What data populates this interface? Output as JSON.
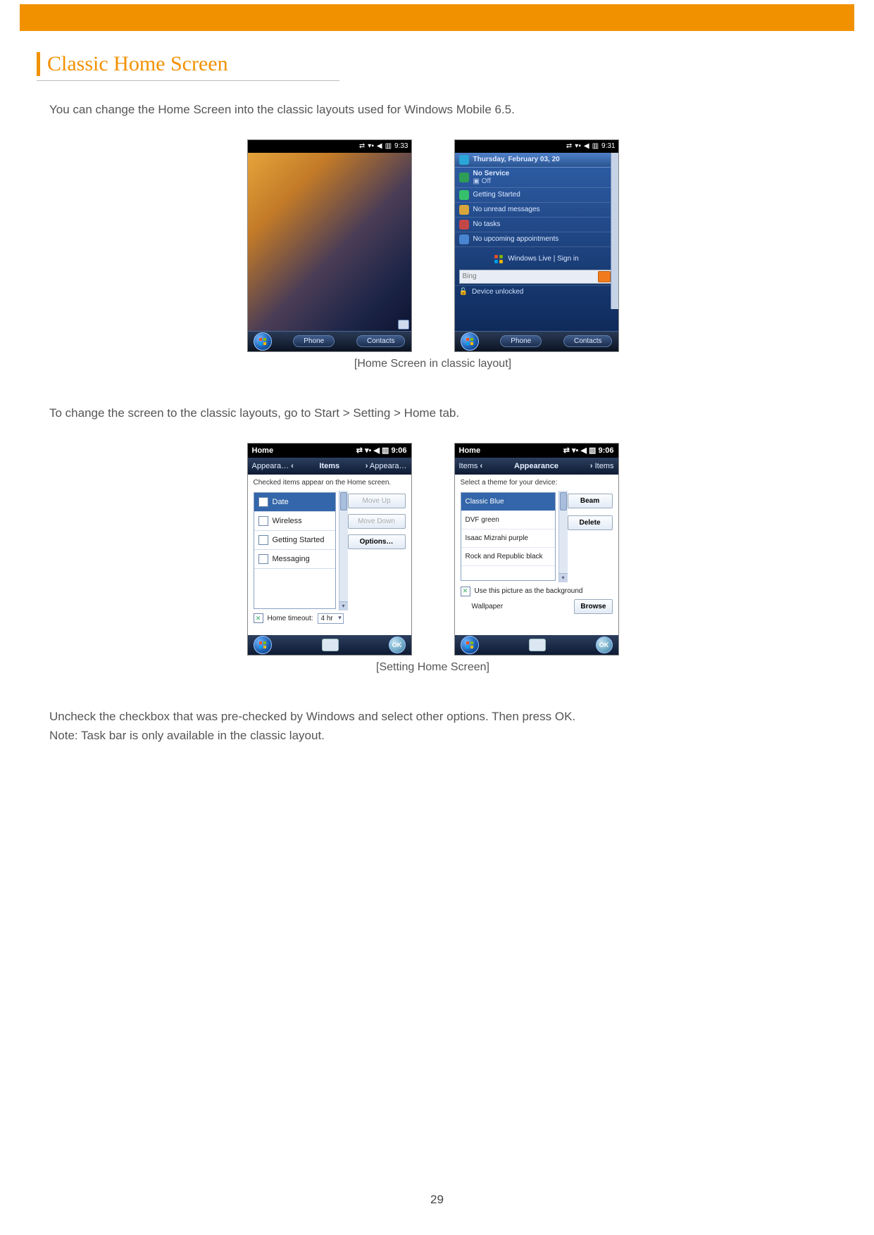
{
  "page": {
    "title": "Classic Home Screen",
    "intro": "You can change the Home Screen into the classic layouts used for Windows Mobile 6.5.",
    "caption1": "[Home Screen in classic layout]",
    "nav_instruction": "To change the screen to the classic layouts, go to Start > Setting > Home tab.",
    "caption2": "[Setting Home Screen]",
    "instruction1": "Uncheck the checkbox that was pre-checked by Windows and select other options. Then press OK.",
    "instruction2": "Note: Task bar is only available in the classic layout.",
    "page_number": "29"
  },
  "phone_home_plain": {
    "time": "9:33",
    "soft_left": "Phone",
    "soft_right": "Contacts"
  },
  "phone_home_classic": {
    "time": "9:31",
    "date": "Thursday, February 03, 20",
    "no_service": "No Service",
    "off": "Off",
    "rows": {
      "getting_started": "Getting Started",
      "no_unread": "No unread messages",
      "no_tasks": "No tasks",
      "no_appts": "No upcoming appointments"
    },
    "wlive": "Windows Live | Sign in",
    "bing_placeholder": "Bing",
    "unlocked": "Device unlocked",
    "soft_left": "Phone",
    "soft_right": "Contacts"
  },
  "settings_items": {
    "title": "Home",
    "time": "9:06",
    "tab_left": "Appeara…",
    "tab_center": "Items",
    "tab_right": "Appeara…",
    "note": "Checked items appear on the Home screen.",
    "list": {
      "date": "Date",
      "wireless": "Wireless",
      "getting_started": "Getting Started",
      "messaging": "Messaging"
    },
    "buttons": {
      "move_up": "Move Up",
      "move_down": "Move Down",
      "options": "Options…"
    },
    "timeout_label": "Home timeout:",
    "timeout_value": "4 hr",
    "ok": "OK"
  },
  "settings_appearance": {
    "title": "Home",
    "time": "9:06",
    "tab_left": "Items",
    "tab_center": "Appearance",
    "tab_right": "Items",
    "note": "Select a theme for your device:",
    "themes": {
      "t1": "Classic Blue",
      "t2": "DVF green",
      "t3": "Isaac Mizrahi purple",
      "t4": "Rock and Republic black"
    },
    "buttons": {
      "beam": "Beam",
      "delete": "Delete",
      "browse": "Browse"
    },
    "bg_checkbox": "Use this picture as the background",
    "wallpaper": "Wallpaper",
    "ok": "OK"
  }
}
